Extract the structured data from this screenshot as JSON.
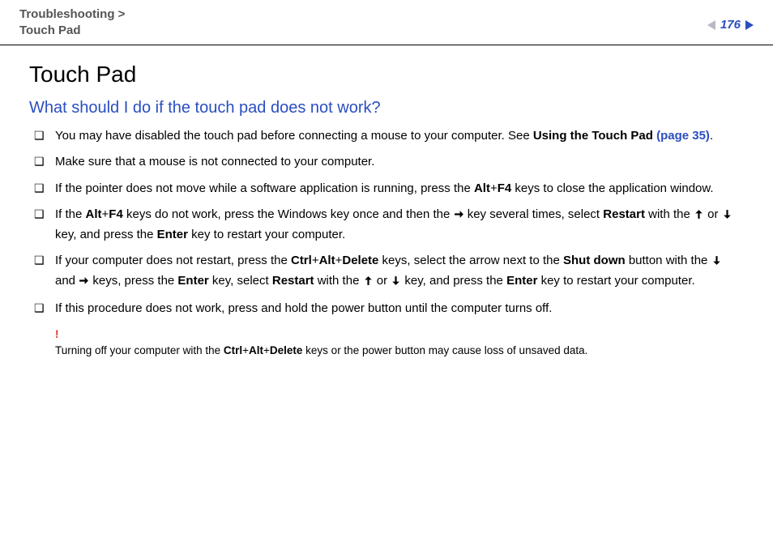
{
  "header": {
    "breadcrumb_top": "Troubleshooting",
    "breadcrumb_sep": ">",
    "breadcrumb_bottom": "Touch Pad",
    "page_number": "176"
  },
  "title": "Touch Pad",
  "subtitle": "What should I do if the touch pad does not work?",
  "bullet_glyph": "❑",
  "bullets": {
    "b1": {
      "pre": "You may have disabled the touch pad before connecting a mouse to your computer. See ",
      "bold_link_label": "Using the Touch Pad ",
      "link_text": "(page 35)",
      "post": "."
    },
    "b2": "Make sure that a mouse is not connected to your computer.",
    "b3": {
      "pre": "If the pointer does not move while a software application is running, press the ",
      "k1": "Alt",
      "plus1": "+",
      "k2": "F4",
      "post": " keys to close the application window."
    },
    "b4": {
      "pre": "If the ",
      "k1": "Alt",
      "plus": "+",
      "k2": "F4",
      "mid1": " keys do not work, press the Windows key once and then the ",
      "mid2": " key several times, select ",
      "k3": "Restart",
      "mid3": " with the ",
      "or": " or ",
      "mid4": " key, and press the ",
      "k4": "Enter",
      "post": " key to restart your computer."
    },
    "b5": {
      "pre": "If your computer does not restart, press the ",
      "k1": "Ctrl",
      "plus": "+",
      "k2": "Alt",
      "k3": "Delete",
      "mid1": " keys, select the arrow next to the ",
      "k4": "Shut down",
      "mid2": " button with the ",
      "and": " and ",
      "mid3": " keys, press the ",
      "k5": "Enter",
      "mid4": " key, select ",
      "k6": "Restart",
      "mid5": " with the ",
      "or": " or ",
      "mid6": " key, and press the ",
      "post": " key to restart your computer."
    },
    "b6": "If this procedure does not work, press and hold the power button until the computer turns off."
  },
  "note": {
    "mark": "!",
    "pre": "Turning off your computer with the ",
    "k1": "Ctrl",
    "plus": "+",
    "k2": "Alt",
    "k3": "Delete",
    "post": " keys or the power button may cause loss of unsaved data."
  }
}
